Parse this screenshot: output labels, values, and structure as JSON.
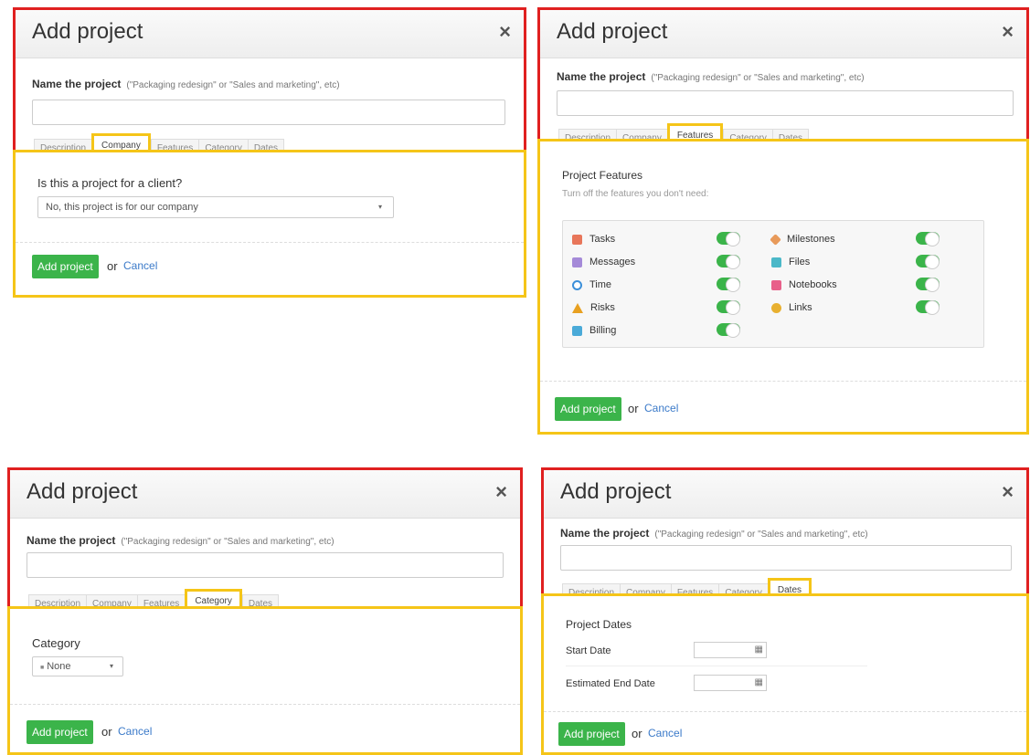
{
  "dialog_title": "Add project",
  "close_icon": "×",
  "name_label": "Name the project",
  "name_hint": "(\"Packaging redesign\" or \"Sales and marketing\", etc)",
  "tabs": [
    "Description",
    "Company",
    "Features",
    "Category",
    "Dates"
  ],
  "add_button": "Add project",
  "or_text": "or",
  "cancel_link": "Cancel",
  "company": {
    "question": "Is this a project for a client?",
    "select_value": "No, this project is for our company",
    "caret": "▾"
  },
  "features": {
    "title": "Project Features",
    "subtitle": "Turn off the features you don't need:",
    "items": [
      {
        "label": "Tasks",
        "icon": "tasks-icon",
        "color": "#e8765a",
        "enabled": true
      },
      {
        "label": "Milestones",
        "icon": "milestones-icon",
        "color": "#e89a5a",
        "enabled": true
      },
      {
        "label": "Messages",
        "icon": "messages-icon",
        "color": "#a58ad8",
        "enabled": true
      },
      {
        "label": "Files",
        "icon": "files-icon",
        "color": "#4bb8c8",
        "enabled": true
      },
      {
        "label": "Time",
        "icon": "time-icon",
        "color": "#3b8fd9",
        "enabled": true
      },
      {
        "label": "Notebooks",
        "icon": "notebooks-icon",
        "color": "#e8608a",
        "enabled": true
      },
      {
        "label": "Risks",
        "icon": "risks-icon",
        "color": "#e8a020",
        "enabled": true
      },
      {
        "label": "Links",
        "icon": "links-icon",
        "color": "#e8b030",
        "enabled": true
      },
      {
        "label": "Billing",
        "icon": "billing-icon",
        "color": "#4aaad8",
        "enabled": true
      }
    ]
  },
  "category": {
    "label": "Category",
    "select_value": "None",
    "caret": "▾",
    "swatch_icon": "■"
  },
  "dates": {
    "title": "Project Dates",
    "start_label": "Start Date",
    "end_label": "Estimated End Date",
    "calendar_icon": "▦"
  }
}
